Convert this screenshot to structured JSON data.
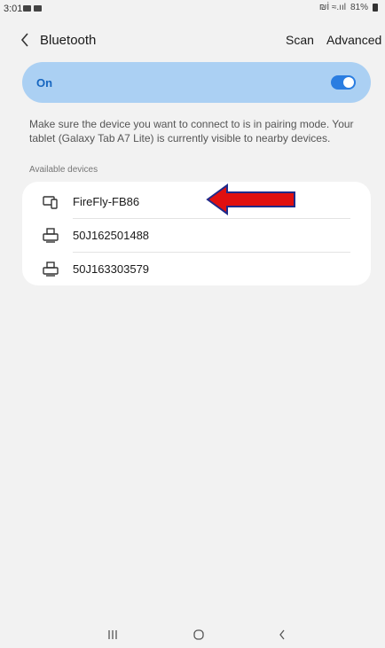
{
  "status_bar": {
    "time": "3:01",
    "signal_text": "₪İ ≈.ııl",
    "battery_percent": "81%"
  },
  "header": {
    "title": "Bluetooth",
    "scan_label": "Scan",
    "advanced_label": "Advanced"
  },
  "bluetooth_toggle": {
    "label": "On",
    "enabled": true,
    "accent_color": "#2a7de1",
    "card_color": "#abd0f3"
  },
  "info_text": "Make sure the device you want to connect to is in pairing mode. Your tablet (Galaxy Tab A7 Lite) is currently visible to nearby devices.",
  "available_devices": {
    "label": "Available devices",
    "items": [
      {
        "name": "FireFly-FB86",
        "icon": "tablet-phone-icon"
      },
      {
        "name": "50J162501488",
        "icon": "printer-icon"
      },
      {
        "name": "50J163303579",
        "icon": "printer-icon"
      }
    ]
  },
  "annotation": {
    "arrow_color": "#e01010",
    "arrow_border": "#1f2a8a"
  },
  "nav_bar": [
    "recents-icon",
    "home-icon",
    "back-icon"
  ]
}
